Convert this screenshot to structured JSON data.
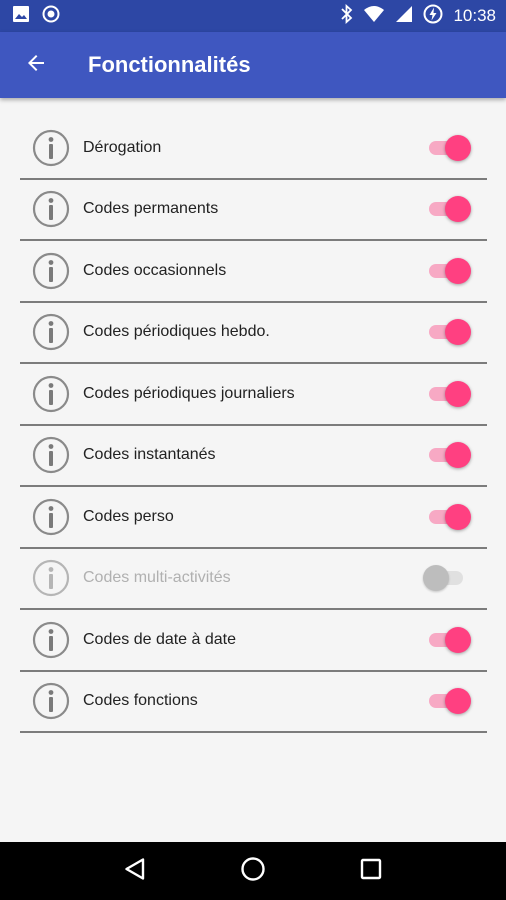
{
  "status_bar": {
    "time": "10:38",
    "icons": [
      "image-icon",
      "record-icon",
      "bluetooth-icon",
      "wifi-icon",
      "signal-icon",
      "battery-charging-icon"
    ]
  },
  "app_bar": {
    "title": "Fonctionnalités",
    "back_icon": "arrow-back-icon"
  },
  "features": [
    {
      "label": "Dérogation",
      "enabled": true,
      "toggle_on": true
    },
    {
      "label": "Codes permanents",
      "enabled": true,
      "toggle_on": true
    },
    {
      "label": "Codes occasionnels",
      "enabled": true,
      "toggle_on": true
    },
    {
      "label": "Codes périodiques hebdo.",
      "enabled": true,
      "toggle_on": true
    },
    {
      "label": "Codes périodiques journaliers",
      "enabled": true,
      "toggle_on": true
    },
    {
      "label": "Codes instantanés",
      "enabled": true,
      "toggle_on": true
    },
    {
      "label": "Codes perso",
      "enabled": true,
      "toggle_on": true
    },
    {
      "label": "Codes multi-activités",
      "enabled": false,
      "toggle_on": false
    },
    {
      "label": "Codes de date à date",
      "enabled": true,
      "toggle_on": true
    },
    {
      "label": "Codes fonctions",
      "enabled": true,
      "toggle_on": true
    }
  ],
  "nav_bar": {
    "icons": [
      "back-triangle-icon",
      "home-circle-icon",
      "recents-square-icon"
    ]
  },
  "colors": {
    "status_bar": "#2d47a5",
    "app_bar": "#3f57c0",
    "accent": "#ff4081",
    "accent_track": "#f7a9c4",
    "background": "#f5f5f5"
  }
}
